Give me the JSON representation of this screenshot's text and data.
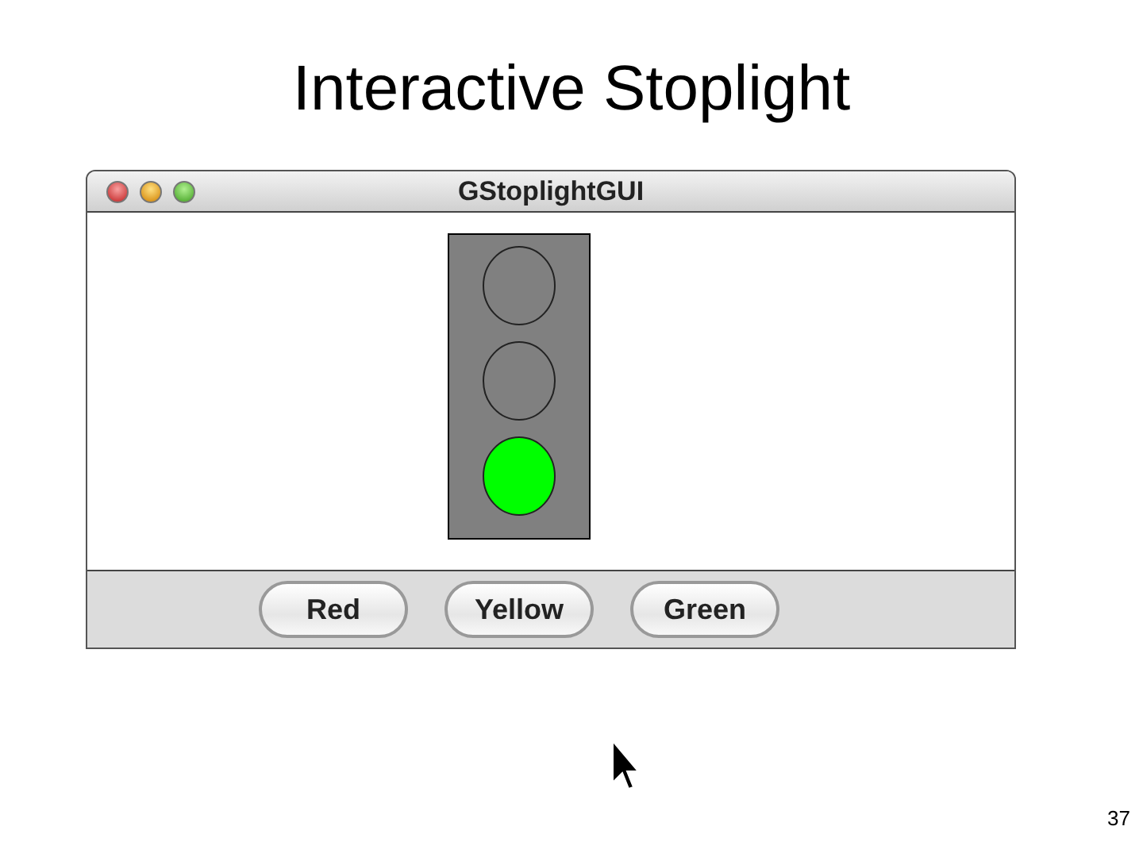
{
  "slide": {
    "title": "Interactive Stoplight",
    "page_number": "37"
  },
  "window": {
    "title": "GStoplightGUI"
  },
  "lights": [
    {
      "on": false
    },
    {
      "on": false
    },
    {
      "on": true,
      "color": "#00ff00"
    }
  ],
  "buttons": [
    "Red",
    "Yellow",
    "Green"
  ]
}
